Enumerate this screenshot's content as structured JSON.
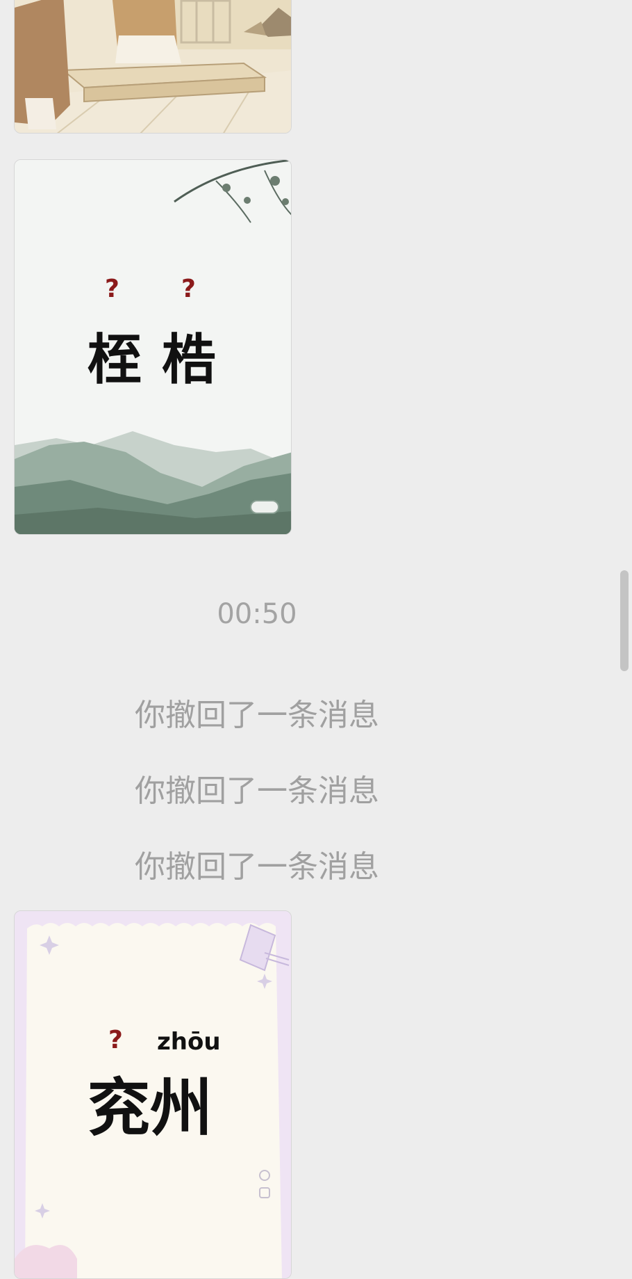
{
  "chat": {
    "timestamp": "00:50",
    "recalled_messages": [
      "你撤回了一条消息",
      "你撤回了一条消息",
      "你撤回了一条消息"
    ]
  },
  "cards": {
    "landscape": {
      "question_marks": [
        "?",
        "?"
      ],
      "chars": [
        "桎",
        "梏"
      ]
    },
    "yanzhou": {
      "question_mark": "?",
      "pinyin": "zhōu",
      "word": "兖州"
    }
  },
  "colors": {
    "background": "#ededed",
    "system_text": "#a0a0a0",
    "question_mark": "#8b1a1a"
  }
}
